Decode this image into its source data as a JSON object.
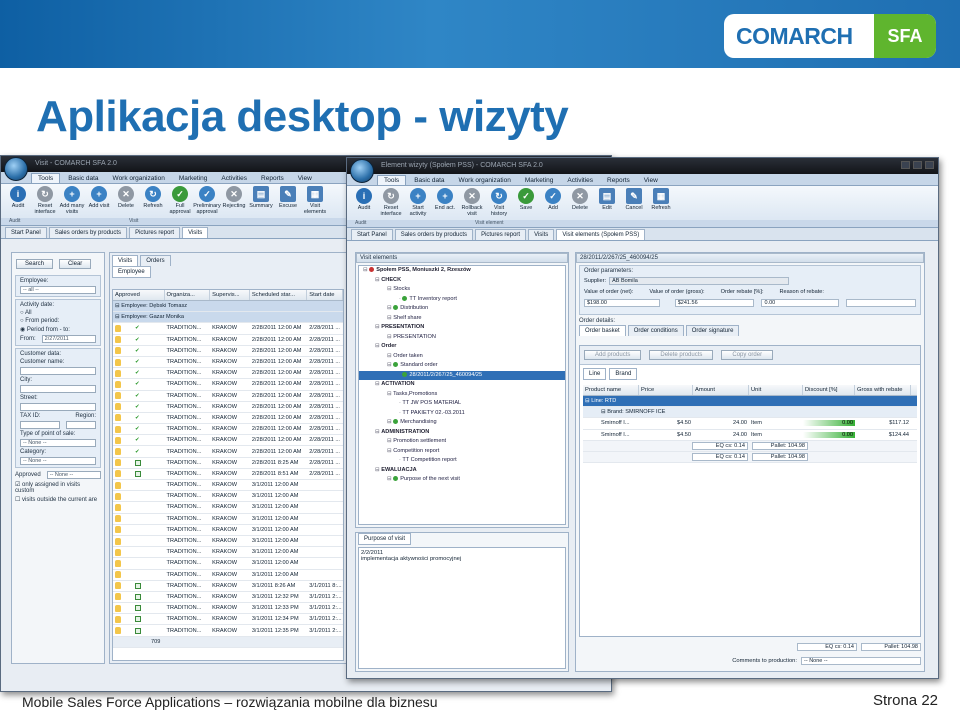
{
  "slide": {
    "title": "Aplikacja desktop - wizyty",
    "logo_main": "COMARCH",
    "logo_badge": "SFA",
    "footer_text": "Mobile Sales Force Applications – rozwiązania mobilne dla biznesu",
    "page_label": "Strona 22",
    "colors": {
      "brand_blue": "#1f6fb2",
      "brand_green": "#5fb52e"
    }
  },
  "left_window": {
    "title": "Visit - COMARCH SFA 2.0",
    "ribbon_tabs": [
      "Tools",
      "Basic data",
      "Work organization",
      "Marketing",
      "Activities",
      "Reports",
      "View"
    ],
    "ribbon_buttons": [
      "Audit",
      "Reset interface",
      "Add many visits",
      "Add visit",
      "Delete",
      "Refresh",
      "Full approval",
      "Preliminary approval",
      "Rejecting",
      "Summary",
      "Excuse",
      "Visit elements"
    ],
    "ribbon_groups": [
      "Audit",
      "Visit"
    ],
    "doc_tabs": [
      "Start Panel",
      "Sales orders by products",
      "Pictures report",
      "Visits"
    ],
    "filter": {
      "search_btn": "Search",
      "clear_btn": "Clear",
      "employee_label": "Employee:",
      "employee_value": "-- all --",
      "activity_date_label": "Activity date:",
      "radio_all": "All",
      "radio_from": "From period:",
      "radio_period": "Period from - to:",
      "from_label": "From:",
      "from_value": "2/27/2011",
      "customer_data_label": "Customer data:",
      "customer_name_label": "Customer name:",
      "city_label": "City:",
      "street_label": "Street:",
      "taxid_label": "TAX ID:",
      "region_label": "Region:",
      "type_label": "Type of point of sale:",
      "type_value": "-- None --",
      "category_label": "Category:",
      "category_value": "-- None --",
      "approved_label": "Approved",
      "approved_value": "-- None --",
      "check1": "only assigned in visits custom",
      "check2": "visits outside the current are"
    },
    "list_tabs": [
      "Visits",
      "Orders"
    ],
    "group_by_label": "Employee",
    "columns": [
      "Approved",
      "Organiza...",
      "Supervis...",
      "Scheduled star...",
      "Start date"
    ],
    "employees": [
      "Employee: Dębski Tomasz",
      "Employee: Gazar Monika"
    ],
    "rows": [
      {
        "org": "TRADITION...",
        "sup": "KRAKÓW",
        "sched": "2/28/2011 12:00 AM",
        "start": "2/28/2011 ...",
        "mark": "v"
      },
      {
        "org": "TRADITION...",
        "sup": "KRAKÓW",
        "sched": "2/28/2011 12:00 AM",
        "start": "2/28/2011 ...",
        "mark": "v"
      },
      {
        "org": "TRADITION...",
        "sup": "KRAKÓW",
        "sched": "2/28/2011 12:00 AM",
        "start": "2/28/2011 ...",
        "mark": "v"
      },
      {
        "org": "TRADITION...",
        "sup": "KRAKÓW",
        "sched": "2/28/2011 12:00 AM",
        "start": "2/28/2011 ...",
        "mark": "v"
      },
      {
        "org": "TRADITION...",
        "sup": "KRAKÓW",
        "sched": "2/28/2011 12:00 AM",
        "start": "2/28/2011 ...",
        "mark": "v"
      },
      {
        "org": "TRADITION...",
        "sup": "KRAKÓW",
        "sched": "2/28/2011 12:00 AM",
        "start": "2/28/2011 ...",
        "mark": "v"
      },
      {
        "org": "TRADITION...",
        "sup": "KRAKÓW",
        "sched": "2/28/2011 12:00 AM",
        "start": "2/28/2011 ...",
        "mark": "v"
      },
      {
        "org": "TRADITION...",
        "sup": "KRAKÓW",
        "sched": "2/28/2011 12:00 AM",
        "start": "2/28/2011 ...",
        "mark": "v"
      },
      {
        "org": "TRADITION...",
        "sup": "KRAKÓW",
        "sched": "2/28/2011 12:00 AM",
        "start": "2/28/2011 ...",
        "mark": "v"
      },
      {
        "org": "TRADITION...",
        "sup": "KRAKÓW",
        "sched": "2/28/2011 12:00 AM",
        "start": "2/28/2011 ...",
        "mark": "v"
      },
      {
        "org": "TRADITION...",
        "sup": "KRAKÓW",
        "sched": "2/28/2011 12:00 AM",
        "start": "2/28/2011 ...",
        "mark": "v"
      },
      {
        "org": "TRADITION...",
        "sup": "KRAKÓW",
        "sched": "2/28/2011 12:00 AM",
        "start": "2/28/2011 ...",
        "mark": "v"
      },
      {
        "org": "TRADITION...",
        "sup": "KRAKÓW",
        "sched": "2/28/2011 8:25 AM",
        "start": "2/28/2011 ...",
        "mark": "c"
      },
      {
        "org": "TRADITION...",
        "sup": "KRAKÓW",
        "sched": "2/28/2011 8:51 AM",
        "start": "2/28/2011 ...",
        "mark": "c"
      },
      {
        "org": "TRADITION...",
        "sup": "KRAKÓW",
        "sched": "3/1/2011 12:00 AM",
        "start": "",
        "mark": ""
      },
      {
        "org": "TRADITION...",
        "sup": "KRAKÓW",
        "sched": "3/1/2011 12:00 AM",
        "start": "",
        "mark": ""
      },
      {
        "org": "TRADITION...",
        "sup": "KRAKÓW",
        "sched": "3/1/2011 12:00 AM",
        "start": "",
        "mark": ""
      },
      {
        "org": "TRADITION...",
        "sup": "KRAKÓW",
        "sched": "3/1/2011 12:00 AM",
        "start": "",
        "mark": ""
      },
      {
        "org": "TRADITION...",
        "sup": "KRAKÓW",
        "sched": "3/1/2011 12:00 AM",
        "start": "",
        "mark": ""
      },
      {
        "org": "TRADITION...",
        "sup": "KRAKÓW",
        "sched": "3/1/2011 12:00 AM",
        "start": "",
        "mark": ""
      },
      {
        "org": "TRADITION...",
        "sup": "KRAKÓW",
        "sched": "3/1/2011 12:00 AM",
        "start": "",
        "mark": ""
      },
      {
        "org": "TRADITION...",
        "sup": "KRAKÓW",
        "sched": "3/1/2011 12:00 AM",
        "start": "",
        "mark": ""
      },
      {
        "org": "TRADITION...",
        "sup": "KRAKÓW",
        "sched": "3/1/2011 12:00 AM",
        "start": "",
        "mark": ""
      },
      {
        "org": "TRADITION...",
        "sup": "KRAKÓW",
        "sched": "3/1/2011 8:26 AM",
        "start": "3/1/2011 8:...",
        "mark": "c"
      },
      {
        "org": "TRADITION...",
        "sup": "KRAKÓW",
        "sched": "3/1/2011 12:32 PM",
        "start": "3/1/2011 2:...",
        "mark": "c"
      },
      {
        "org": "TRADITION...",
        "sup": "KRAKÓW",
        "sched": "3/1/2011 12:33 PM",
        "start": "3/1/2011 2:...",
        "mark": "c"
      },
      {
        "org": "TRADITION...",
        "sup": "KRAKÓW",
        "sched": "3/1/2011 12:34 PM",
        "start": "3/1/2011 2:...",
        "mark": "c"
      },
      {
        "org": "TRADITION...",
        "sup": "KRAKÓW",
        "sched": "3/1/2011 12:35 PM",
        "start": "3/1/2011 2:...",
        "mark": "c"
      }
    ],
    "row_count": "709"
  },
  "right_window": {
    "title": "Element wizyty (Społem PSS) - COMARCH SFA 2.0",
    "ribbon_tabs": [
      "Tools",
      "Basic data",
      "Work organization",
      "Marketing",
      "Activities",
      "Reports",
      "View"
    ],
    "ribbon_buttons": [
      "Audit",
      "Reset interface",
      "Start activity",
      "End act.",
      "Rollback visit",
      "Visit history",
      "Save",
      "Add",
      "Delete",
      "Edit",
      "Cancel",
      "Refresh"
    ],
    "ribbon_groups": [
      "Audit",
      "Visit element"
    ],
    "doc_tabs": [
      "Start Panel",
      "Sales orders by products",
      "Pictures report",
      "Visits",
      "Visit elements (Społem PSS)"
    ],
    "tree_header": "Visit elements",
    "tree": [
      {
        "t": "Społem PSS, Moniuszki 2, Rzeszów",
        "lvl": 0,
        "bold": true,
        "dot": "r"
      },
      {
        "t": "CHECK",
        "lvl": 1,
        "bold": true,
        "dot": ""
      },
      {
        "t": "Stocks",
        "lvl": 2,
        "bold": false,
        "dot": ""
      },
      {
        "t": "TT Inventory report",
        "lvl": 3,
        "bold": false,
        "dot": "g"
      },
      {
        "t": "Distribution",
        "lvl": 2,
        "bold": false,
        "dot": "g"
      },
      {
        "t": "Shelf share",
        "lvl": 2,
        "bold": false,
        "dot": ""
      },
      {
        "t": "PRESENTATION",
        "lvl": 1,
        "bold": true,
        "dot": ""
      },
      {
        "t": "PRESENTATION",
        "lvl": 2,
        "bold": false,
        "dot": ""
      },
      {
        "t": "Order",
        "lvl": 1,
        "bold": true,
        "dot": ""
      },
      {
        "t": "Order taken",
        "lvl": 2,
        "bold": false,
        "dot": ""
      },
      {
        "t": "Standard order",
        "lvl": 2,
        "bold": false,
        "dot": "g"
      },
      {
        "t": "28/2011/2/267/25_460094/25",
        "lvl": 3,
        "bold": false,
        "dot": "g",
        "sel": true
      },
      {
        "t": "ACTIVATION",
        "lvl": 1,
        "bold": true,
        "dot": ""
      },
      {
        "t": "Tasks,Promotions",
        "lvl": 2,
        "bold": false,
        "dot": ""
      },
      {
        "t": "TT JW POS MATERIAL",
        "lvl": 3,
        "bold": false,
        "dot": ""
      },
      {
        "t": "TT PAKIETY 02.-03.2011",
        "lvl": 3,
        "bold": false,
        "dot": ""
      },
      {
        "t": "Merchandising",
        "lvl": 2,
        "bold": false,
        "dot": "g"
      },
      {
        "t": "ADMINISTRATION",
        "lvl": 1,
        "bold": true,
        "dot": ""
      },
      {
        "t": "Promotion settlement",
        "lvl": 2,
        "bold": false,
        "dot": ""
      },
      {
        "t": "Competition report",
        "lvl": 2,
        "bold": false,
        "dot": ""
      },
      {
        "t": "TT Competition report",
        "lvl": 3,
        "bold": false,
        "dot": ""
      },
      {
        "t": "EWALUACJA",
        "lvl": 1,
        "bold": true,
        "dot": ""
      },
      {
        "t": "Purpose of the next visit",
        "lvl": 2,
        "bold": false,
        "dot": "g"
      }
    ],
    "purpose_tab": "Purpose of visit",
    "purpose_date": "2/2/2011",
    "purpose_text": "implementacja aktywności promocyjnej",
    "order_id": "28/2011/2/267/25_460094/25",
    "order_params_label": "Order parameters:",
    "supplier_label": "Supplier:",
    "supplier_value": "AB Bomila",
    "value_net_label": "Value of order (net):",
    "value_net": "$198.00",
    "value_gross_label": "Value of order (gross):",
    "value_gross": "$241.56",
    "rebate_label": "Order rebate [%]:",
    "rebate_value": "0.00",
    "reason_label": "Reason of rebate:",
    "order_details_label": "Order details:",
    "detail_tabs": [
      "Order basket",
      "Order conditions",
      "Order signature"
    ],
    "basket_buttons": [
      "Add products",
      "Delete products",
      "Copy order"
    ],
    "group_line": "Line",
    "group_brand": "Brand",
    "product_columns": [
      "Product name",
      "Price",
      "Amount",
      "Unit",
      "Discount [%]",
      "Gross with rebate"
    ],
    "line_row": "Line: RTD",
    "brand_row": "Brand: SMIRNOFF ICE",
    "products": [
      {
        "name": "Smirnoff I...",
        "price": "$4.50",
        "amount": "24.00",
        "unit": "Item",
        "disc": "0.00",
        "gross": "$117.12"
      },
      {
        "name": "Smirnoff I...",
        "price": "$4.50",
        "amount": "24.00",
        "unit": "Item",
        "disc": "0.00",
        "gross": "$124.44"
      }
    ],
    "summary1": "EQ cs: 0.14",
    "summary2": "Pallet: 104.98",
    "summary3": "EQ cs: 0.14",
    "summary4": "Pallet: 104.98",
    "bottom_eq": "EQ cs: 0.14",
    "bottom_pallet": "Pallet: 104.98",
    "comments_label": "Comments to production:",
    "comments_value": "-- None --"
  }
}
